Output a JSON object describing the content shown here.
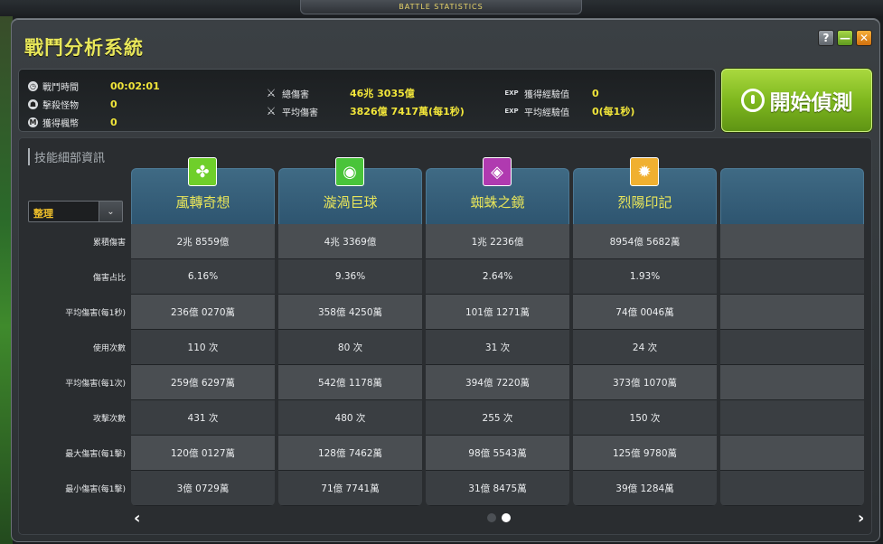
{
  "topbar": {
    "title": "BATTLE STATISTICS"
  },
  "window": {
    "title": "戰鬥分析系統",
    "help": "?",
    "minimize": "—",
    "close": "✕"
  },
  "summary": {
    "col1": [
      {
        "icon": "clock-icon",
        "glyph": "◷",
        "label": "戰鬥時間",
        "value": "00:02:01"
      },
      {
        "icon": "monster-icon",
        "glyph": "☗",
        "label": "擊殺怪物",
        "value": "0"
      },
      {
        "icon": "meso-icon",
        "glyph": "M",
        "label": "獲得楓幣",
        "value": "0"
      }
    ],
    "col2": [
      {
        "icon": "sword-icon",
        "glyph": "⚔",
        "label": "總傷害",
        "value": "46兆 3035億"
      },
      {
        "icon": "sword-icon",
        "glyph": "⚔",
        "label": "平均傷害",
        "value": "3826億 7417萬(每1秒)"
      }
    ],
    "col3": [
      {
        "icon": "exp-icon",
        "glyph": "EXP",
        "label": "獲得經驗值",
        "value": "0"
      },
      {
        "icon": "exp-icon",
        "glyph": "EXP",
        "label": "平均經驗值",
        "value": "0(每1秒)"
      }
    ]
  },
  "start_button": {
    "label": "開始偵測"
  },
  "detail": {
    "title": "技能細部資訊",
    "sort": {
      "selected": "整理",
      "arrow": "⌄"
    },
    "row_labels": [
      "累積傷害",
      "傷害占比",
      "平均傷害(每1秒)",
      "使用次數",
      "平均傷害(每1次)",
      "攻擊次數",
      "最大傷害(每1擊)",
      "最小傷害(每1擊)"
    ],
    "skills": [
      {
        "name": "颪轉奇想",
        "icon_glyph": "✤",
        "icon_color": "#6fcf2a",
        "values": [
          "2兆 8559億",
          "6.16%",
          "236億 0270萬",
          "110 次",
          "259億 6297萬",
          "431 次",
          "120億 0127萬",
          "3億 0729萬"
        ]
      },
      {
        "name": "漩渦巨球",
        "icon_glyph": "◉",
        "icon_color": "#49c43a",
        "values": [
          "4兆 3369億",
          "9.36%",
          "358億 4250萬",
          "80 次",
          "542億 1178萬",
          "480 次",
          "128億 7462萬",
          "71億 7741萬"
        ]
      },
      {
        "name": "蜘蛛之鏡",
        "icon_glyph": "◈",
        "icon_color": "#b03ab0",
        "values": [
          "1兆 2236億",
          "2.64%",
          "101億 1271萬",
          "31 次",
          "394億 7220萬",
          "255 次",
          "98億 5543萬",
          "31億 8475萬"
        ]
      },
      {
        "name": "烈陽印記",
        "icon_glyph": "✹",
        "icon_color": "#f0b030",
        "values": [
          "8954億 5682萬",
          "1.93%",
          "74億 0046萬",
          "24 次",
          "373億 1070萬",
          "150 次",
          "125億 9780萬",
          "39億 1284萬"
        ]
      },
      {
        "name": "",
        "icon_glyph": "",
        "icon_color": "",
        "values": [
          "",
          "",
          "",
          "",
          "",
          "",
          "",
          ""
        ]
      }
    ],
    "pager": {
      "prev": "‹",
      "next": "›",
      "pages": 2,
      "active": 1
    }
  }
}
